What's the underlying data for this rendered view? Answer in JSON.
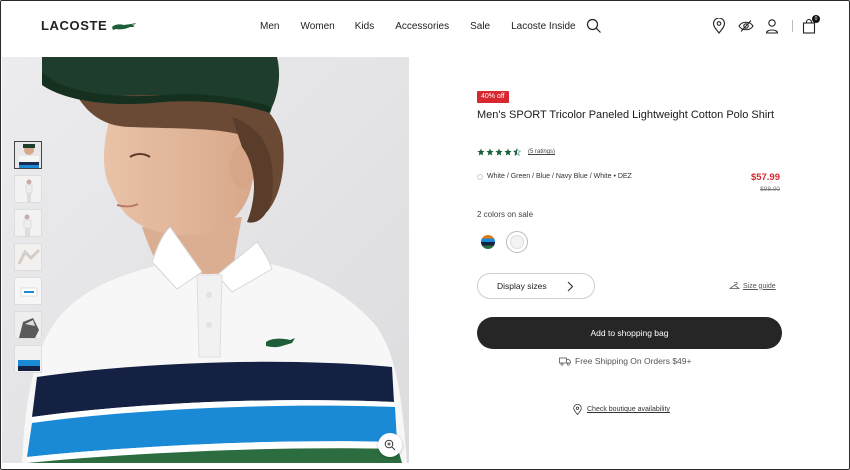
{
  "brand": {
    "name": "LACOSTE",
    "accent_color": "#1b5e3a"
  },
  "nav": {
    "items": [
      "Men",
      "Women",
      "Kids",
      "Accessories",
      "Sale",
      "Lacoste Inside"
    ]
  },
  "header_icons": [
    "search-icon",
    "store-locator-icon",
    "eye-icon",
    "account-icon",
    "shopping-bag-icon"
  ],
  "bag_count": "0",
  "gallery": {
    "thumbnail_count": 7,
    "active_index": 0
  },
  "product": {
    "badge": "40% off",
    "badge_color": "#d7282f",
    "title": "Men's SPORT Tricolor Paneled Lightweight Cotton Polo Shirt",
    "rating_stars": 4.5,
    "rating_link": "(5 ratings)",
    "color_name": "White / Green / Blue / Navy Blue / White • DEZ",
    "price": "$57.99",
    "old_price": "$98.00",
    "sale_colors_label": "2 colors on sale",
    "sizes_button": "Display sizes",
    "size_guide": "Size guide",
    "add_to_bag": "Add to shopping bag",
    "shipping": "Free Shipping On Orders $49+",
    "boutique": "Check boutique availability"
  }
}
